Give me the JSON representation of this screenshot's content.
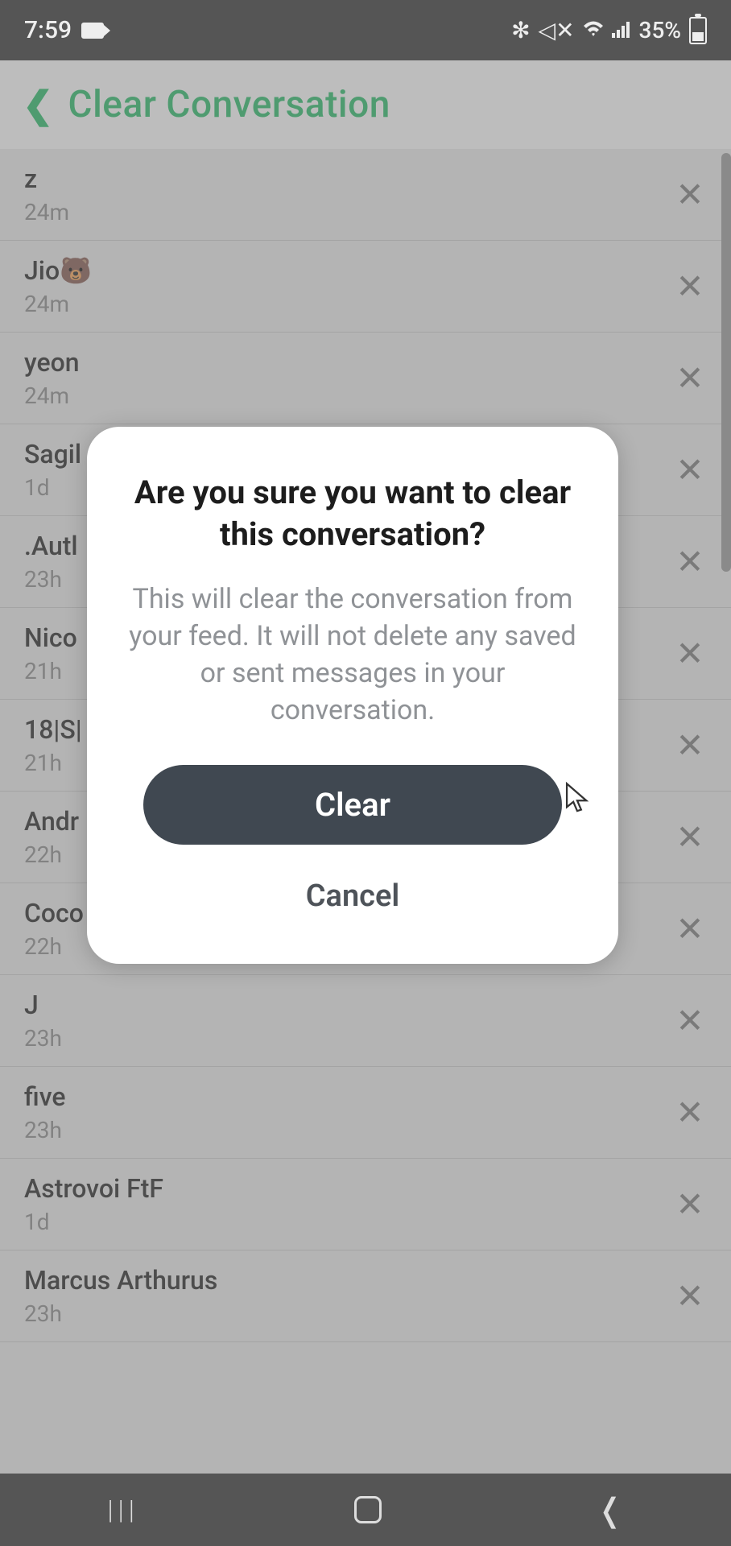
{
  "status_bar": {
    "time": "7:59",
    "battery_pct": "35%"
  },
  "header": {
    "title": "Clear Conversation"
  },
  "conversations": [
    {
      "name": "z",
      "time": "24m"
    },
    {
      "name": "Jio🐻",
      "time": "24m"
    },
    {
      "name": "yeon",
      "time": "24m"
    },
    {
      "name": "Sagil",
      "time": "1d"
    },
    {
      "name": ".Autl",
      "time": "23h"
    },
    {
      "name": "Nico",
      "time": "21h"
    },
    {
      "name": "18|S|",
      "time": "21h"
    },
    {
      "name": "Andr",
      "time": "22h"
    },
    {
      "name": "Coco",
      "time": "22h"
    },
    {
      "name": "J",
      "time": "23h"
    },
    {
      "name": "five",
      "time": "23h"
    },
    {
      "name": "Astrovoi FtF",
      "time": "1d"
    },
    {
      "name": "Marcus Arthurus",
      "time": "23h"
    }
  ],
  "modal": {
    "title": "Are you sure you want to clear this conversation?",
    "body": "This will clear the conversation from your feed. It will not delete any saved or sent messages in your conversation.",
    "clear_label": "Clear",
    "cancel_label": "Cancel"
  }
}
